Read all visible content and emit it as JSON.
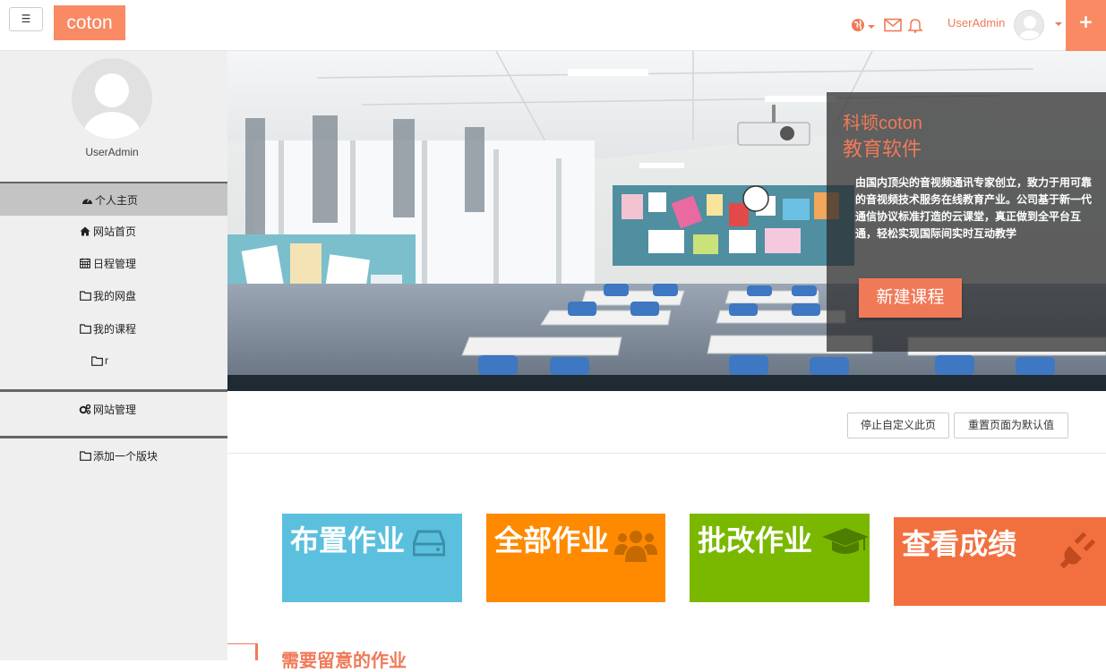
{
  "header": {
    "menu_label": "☰",
    "brand": "coton",
    "username": "UserAdmin",
    "plus_label": "+"
  },
  "sidebar": {
    "username": "UserAdmin",
    "items": [
      {
        "label": "个人主页",
        "icon": "dashboard-icon",
        "active": true
      },
      {
        "label": "网站首页",
        "icon": "home-icon"
      },
      {
        "label": "日程管理",
        "icon": "calendar-icon"
      },
      {
        "label": "我的网盘",
        "icon": "folder-icon"
      },
      {
        "label": "我的课程",
        "icon": "folder-icon"
      },
      {
        "label": "r",
        "icon": "folder-icon"
      },
      {
        "label": "网站管理",
        "icon": "cogs-icon"
      },
      {
        "label": "添加一个版块",
        "icon": "folder-icon"
      }
    ]
  },
  "banner": {
    "title_line1": "科顿coton",
    "title_line2": "教育软件",
    "description": "由国内顶尖的音视频通讯专家创立，致力于用可靠的音视频技术服务在线教育产业。公司基于新一代通信协议标准打造的云课堂，真正做到全平台互通，轻松实现国际间实时互动教学",
    "cta": "新建课程"
  },
  "actions": {
    "stop_customize": "停止自定义此页",
    "reset_default": "重置页面为默认值"
  },
  "tiles": [
    {
      "label": "布置作业",
      "icon": "hdd-icon",
      "color": "#5bc0de"
    },
    {
      "label": "全部作业",
      "icon": "users-icon",
      "color": "#ff8a00"
    },
    {
      "label": "批改作业",
      "icon": "graduation-cap-icon",
      "color": "#7ab800"
    },
    {
      "label": "查看成绩",
      "icon": "plug-icon",
      "color": "#f2703f"
    }
  ],
  "section": {
    "title": "需要留意的作业"
  },
  "colors": {
    "accent": "#f98a63",
    "accent_text": "#f07a58",
    "sidebar_bg": "#efefef"
  }
}
